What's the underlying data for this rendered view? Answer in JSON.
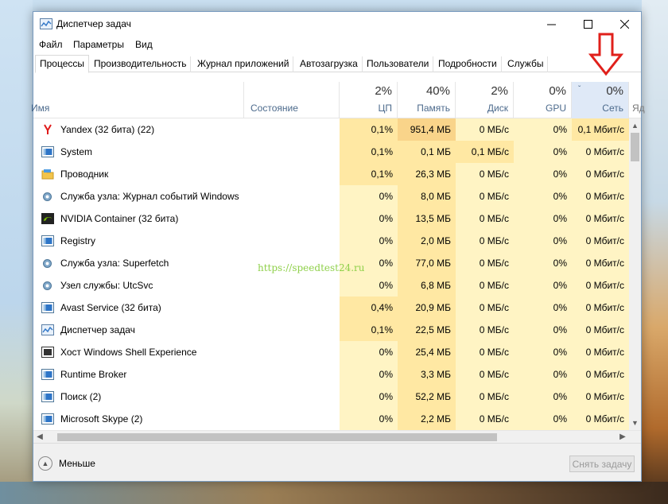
{
  "window": {
    "title": "Диспетчер задач"
  },
  "menu": [
    "Файл",
    "Параметры",
    "Вид"
  ],
  "tabs": [
    "Процессы",
    "Производительность",
    "Журнал приложений",
    "Автозагрузка",
    "Пользователи",
    "Подробности",
    "Службы"
  ],
  "columns": {
    "name": {
      "label": "Имя"
    },
    "state": {
      "label": "Состояние"
    },
    "cpu": {
      "pct": "2%",
      "label": "ЦП"
    },
    "mem": {
      "pct": "40%",
      "label": "Память"
    },
    "disk": {
      "pct": "2%",
      "label": "Диск"
    },
    "gpu": {
      "pct": "0%",
      "label": "GPU"
    },
    "net": {
      "pct": "0%",
      "label": "Сеть"
    },
    "extra": {
      "label": "Яд"
    }
  },
  "processes": [
    {
      "name": "Yandex (32 бита) (22)",
      "icon": "yandex-icon",
      "cpu": "0,1%",
      "mem": "951,4 МБ",
      "disk": "0 МБ/с",
      "gpu": "0%",
      "net": "0,1 Мбит/с"
    },
    {
      "name": "System",
      "icon": "system-icon",
      "cpu": "0,1%",
      "mem": "0,1 МБ",
      "disk": "0,1 МБ/с",
      "gpu": "0%",
      "net": "0 Мбит/с"
    },
    {
      "name": "Проводник",
      "icon": "folder-icon",
      "cpu": "0,1%",
      "mem": "26,3 МБ",
      "disk": "0 МБ/с",
      "gpu": "0%",
      "net": "0 Мбит/с"
    },
    {
      "name": "Служба узла: Журнал событий Windows",
      "icon": "gear-icon",
      "cpu": "0%",
      "mem": "8,0 МБ",
      "disk": "0 МБ/с",
      "gpu": "0%",
      "net": "0 Мбит/с"
    },
    {
      "name": "NVIDIA Container (32 бита)",
      "icon": "nvidia-icon",
      "cpu": "0%",
      "mem": "13,5 МБ",
      "disk": "0 МБ/с",
      "gpu": "0%",
      "net": "0 Мбит/с"
    },
    {
      "name": "Registry",
      "icon": "system-icon",
      "cpu": "0%",
      "mem": "2,0 МБ",
      "disk": "0 МБ/с",
      "gpu": "0%",
      "net": "0 Мбит/с"
    },
    {
      "name": "Служба узла: Superfetch",
      "icon": "gear-icon",
      "cpu": "0%",
      "mem": "77,0 МБ",
      "disk": "0 МБ/с",
      "gpu": "0%",
      "net": "0 Мбит/с"
    },
    {
      "name": "Узел службы: UtcSvc",
      "icon": "gear-icon",
      "cpu": "0%",
      "mem": "6,8 МБ",
      "disk": "0 МБ/с",
      "gpu": "0%",
      "net": "0 Мбит/с"
    },
    {
      "name": "Avast Service (32 бита)",
      "icon": "system-icon",
      "cpu": "0,4%",
      "mem": "20,9 МБ",
      "disk": "0 МБ/с",
      "gpu": "0%",
      "net": "0 Мбит/с"
    },
    {
      "name": "Диспетчер задач",
      "icon": "task-manager-icon",
      "cpu": "0,1%",
      "mem": "22,5 МБ",
      "disk": "0 МБ/с",
      "gpu": "0%",
      "net": "0 Мбит/с"
    },
    {
      "name": "Хост Windows Shell Experience",
      "icon": "shell-icon",
      "leaf": true,
      "cpu": "0%",
      "mem": "25,4 МБ",
      "disk": "0 МБ/с",
      "gpu": "0%",
      "net": "0 Мбит/с"
    },
    {
      "name": "Runtime Broker",
      "icon": "system-icon",
      "cpu": "0%",
      "mem": "3,3 МБ",
      "disk": "0 МБ/с",
      "gpu": "0%",
      "net": "0 Мбит/с"
    },
    {
      "name": "Поиск (2)",
      "icon": "system-icon",
      "leaf": true,
      "cpu": "0%",
      "mem": "52,2 МБ",
      "disk": "0 МБ/с",
      "gpu": "0%",
      "net": "0 Мбит/с"
    },
    {
      "name": "Microsoft Skype (2)",
      "icon": "system-icon",
      "leaf": true,
      "cpu": "0%",
      "mem": "2,2 МБ",
      "disk": "0 МБ/с",
      "gpu": "0%",
      "net": "0 Мбит/с"
    }
  ],
  "footer": {
    "fewer_label": "Меньше",
    "end_task_label": "Снять задачу"
  },
  "watermark": "https://speedtest24.ru",
  "colors": {
    "heat_light": "#fff4c4",
    "heat_medium": "#ffe8a3",
    "heat_strong": "#f9d48a",
    "net_header": "#dfe9f7",
    "annotation_red": "#e0201b"
  }
}
